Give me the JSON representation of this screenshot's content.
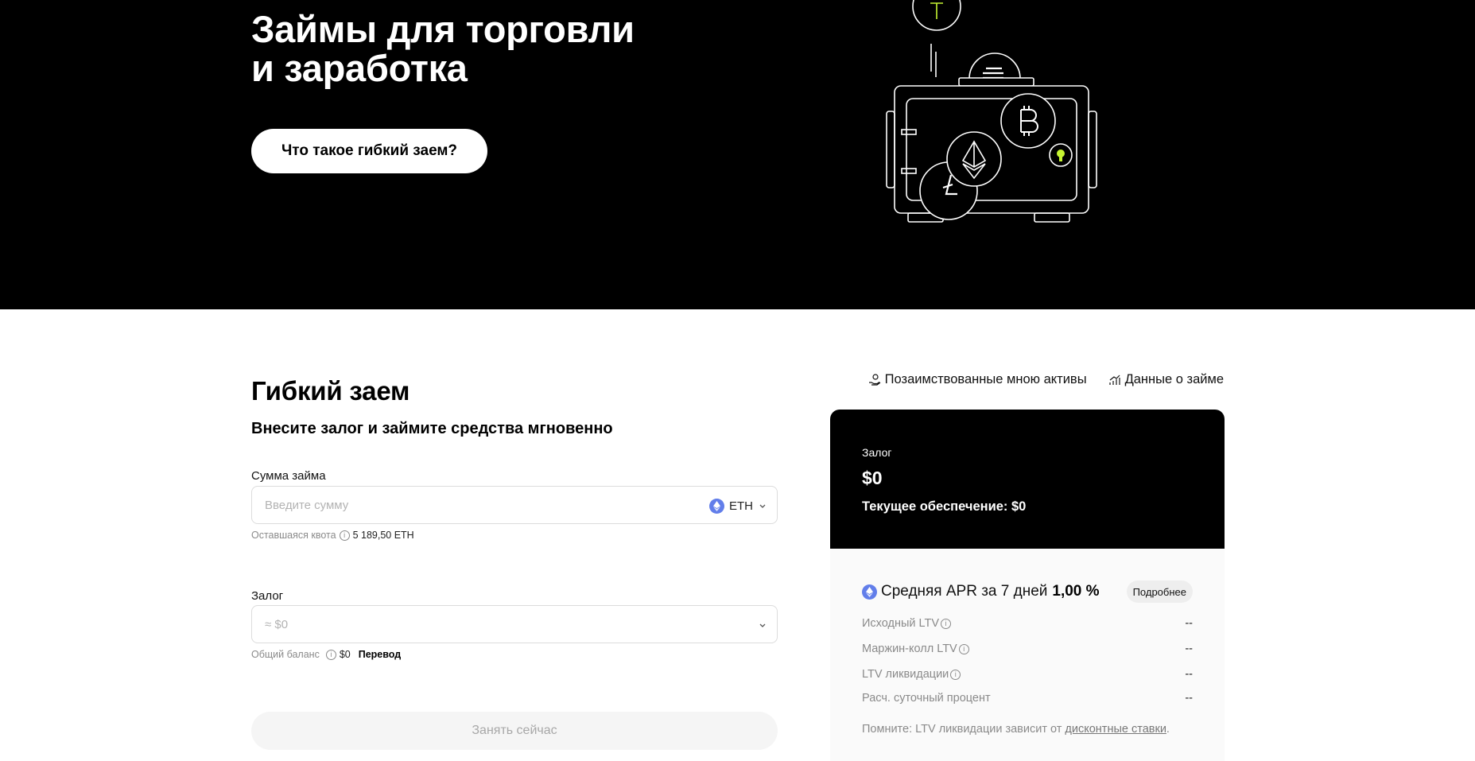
{
  "hero": {
    "title_line1": "Займы для торговли",
    "title_line2": "и заработка",
    "button_label": "Что такое гибкий заем?"
  },
  "loan": {
    "title": "Гибкий заем",
    "subtitle": "Внесите залог и займите средства мгновенно",
    "amount": {
      "label": "Сумма займа",
      "placeholder": "Введите сумму",
      "value": "",
      "currency": "ETH",
      "quota_label": "Оставшаяся квота",
      "quota_value": "5 189,50 ETH"
    },
    "collateral": {
      "label": "Залог",
      "placeholder": "≈ $0",
      "balance_label": "Общий баланс",
      "balance_value": "$0",
      "transfer_label": "Перевод"
    },
    "borrow_button": "Занять сейчас"
  },
  "top_links": {
    "borrowed_assets": "Позаимствованные мною активы",
    "loan_data": "Данные о займе"
  },
  "summary": {
    "collateral_label": "Залог",
    "collateral_value": "$0",
    "current_collateral": "Текущее обеспечение: $0",
    "apr_label": "Средняя APR за 7 дней",
    "apr_value": "1,00 %",
    "more_button": "Подробнее",
    "stats": [
      {
        "label": "Исходный LTV",
        "value": "--"
      },
      {
        "label": "Маржин-колл LTV",
        "value": "--"
      },
      {
        "label": "LTV ликвидации",
        "value": "--"
      },
      {
        "label": "Расч. суточный процент",
        "value": "--"
      }
    ],
    "note_prefix": "Помните: LTV ликвидации зависит от ",
    "note_link": "дисконтные ставки",
    "note_suffix": "."
  },
  "colors": {
    "accent_green": "#c6f432",
    "eth_blue": "#627eea",
    "hero_bg": "#000000"
  }
}
